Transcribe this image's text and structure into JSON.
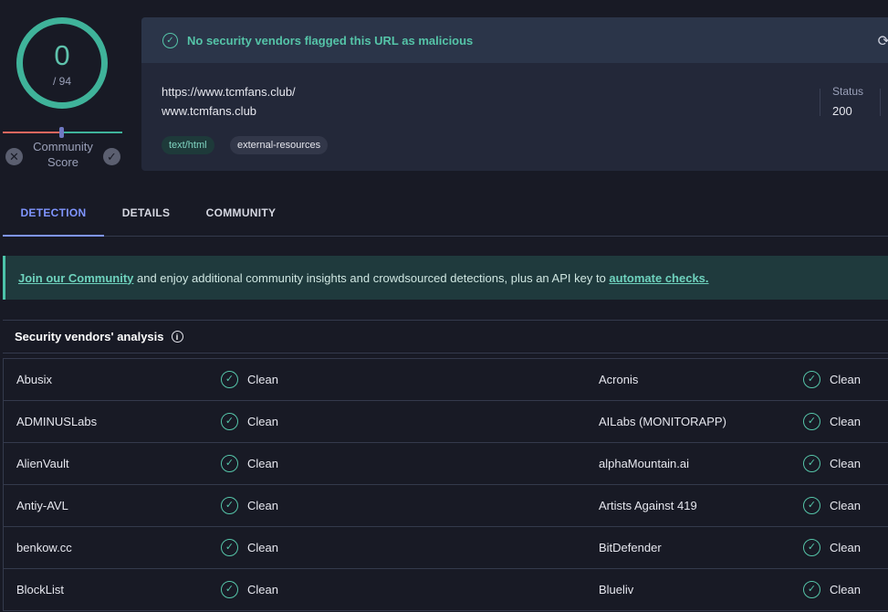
{
  "score": {
    "value": "0",
    "total": "/ 94",
    "community_label": "Community Score"
  },
  "summary": {
    "banner_text": "No security vendors flagged this URL as malicious",
    "url": "https://www.tcmfans.club/",
    "domain": "www.tcmfans.club",
    "tags": [
      "text/html",
      "external-resources"
    ],
    "status_label": "Status",
    "status_value": "200"
  },
  "tabs": [
    {
      "label": "DETECTION",
      "active": true
    },
    {
      "label": "DETAILS",
      "active": false
    },
    {
      "label": "COMMUNITY",
      "active": false
    }
  ],
  "join_banner": {
    "link_text": "Join our Community",
    "middle_text": " and enjoy additional community insights and crowdsourced detections, plus an API key to ",
    "automate_text": "automate checks."
  },
  "vendors": {
    "header": "Security vendors' analysis",
    "rows": [
      {
        "left_name": "Abusix",
        "left_result": "Clean",
        "right_name": "Acronis",
        "right_result": "Clean"
      },
      {
        "left_name": "ADMINUSLabs",
        "left_result": "Clean",
        "right_name": "AILabs (MONITORAPP)",
        "right_result": "Clean"
      },
      {
        "left_name": "AlienVault",
        "left_result": "Clean",
        "right_name": "alphaMountain.ai",
        "right_result": "Clean"
      },
      {
        "left_name": "Antiy-AVL",
        "left_result": "Clean",
        "right_name": "Artists Against 419",
        "right_result": "Clean"
      },
      {
        "left_name": "benkow.cc",
        "left_result": "Clean",
        "right_name": "BitDefender",
        "right_result": "Clean"
      },
      {
        "left_name": "BlockList",
        "left_result": "Clean",
        "right_name": "Blueliv",
        "right_result": "Clean"
      }
    ]
  },
  "colors": {
    "accent": "#7f95ff",
    "clean": "#55c4a8",
    "background": "#181a25"
  }
}
